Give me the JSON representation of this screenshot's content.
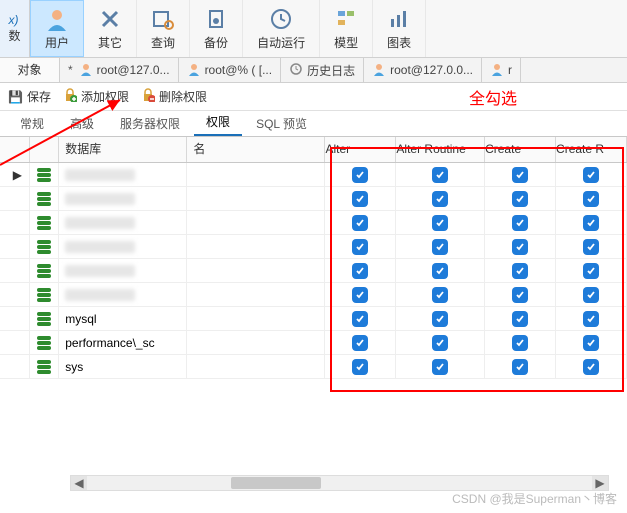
{
  "ribbon": {
    "fx": "x)",
    "fx_sub": "数",
    "items": [
      {
        "label": "用户",
        "active": true
      },
      {
        "label": "其它"
      },
      {
        "label": "查询"
      },
      {
        "label": "备份"
      },
      {
        "label": "自动运行"
      },
      {
        "label": "模型"
      },
      {
        "label": "图表"
      }
    ]
  },
  "sidelabel": "对象",
  "doctabs": [
    {
      "label": "root@127.0...",
      "dirty": true,
      "icon": "person"
    },
    {
      "label": "root@% ( [...",
      "dirty": false,
      "icon": "person"
    },
    {
      "label": "历史日志",
      "dirty": false,
      "icon": "history"
    },
    {
      "label": "root@127.0.0...",
      "dirty": false,
      "icon": "person"
    },
    {
      "label": "r",
      "dirty": false,
      "icon": "person"
    }
  ],
  "actions": {
    "save": "保存",
    "add_priv": "添加权限",
    "del_priv": "删除权限"
  },
  "annotation": "全勾选",
  "innertabs": [
    "常规",
    "高级",
    "服务器权限",
    "权限",
    "SQL 预览"
  ],
  "innertabs_active": 3,
  "grid": {
    "headers": {
      "db": "数据库",
      "name": "名",
      "privs": [
        "Alter",
        "Alter Routine",
        "Create",
        "Create R"
      ]
    },
    "rows": [
      {
        "blurred": true,
        "selected": true
      },
      {
        "blurred": true
      },
      {
        "blurred": true
      },
      {
        "blurred": true
      },
      {
        "blurred": true
      },
      {
        "blurred": true
      },
      {
        "name": "mysql"
      },
      {
        "name": "performance\\_sc"
      },
      {
        "name": "sys"
      }
    ]
  },
  "watermark": "CSDN @我是Superman丶博客"
}
